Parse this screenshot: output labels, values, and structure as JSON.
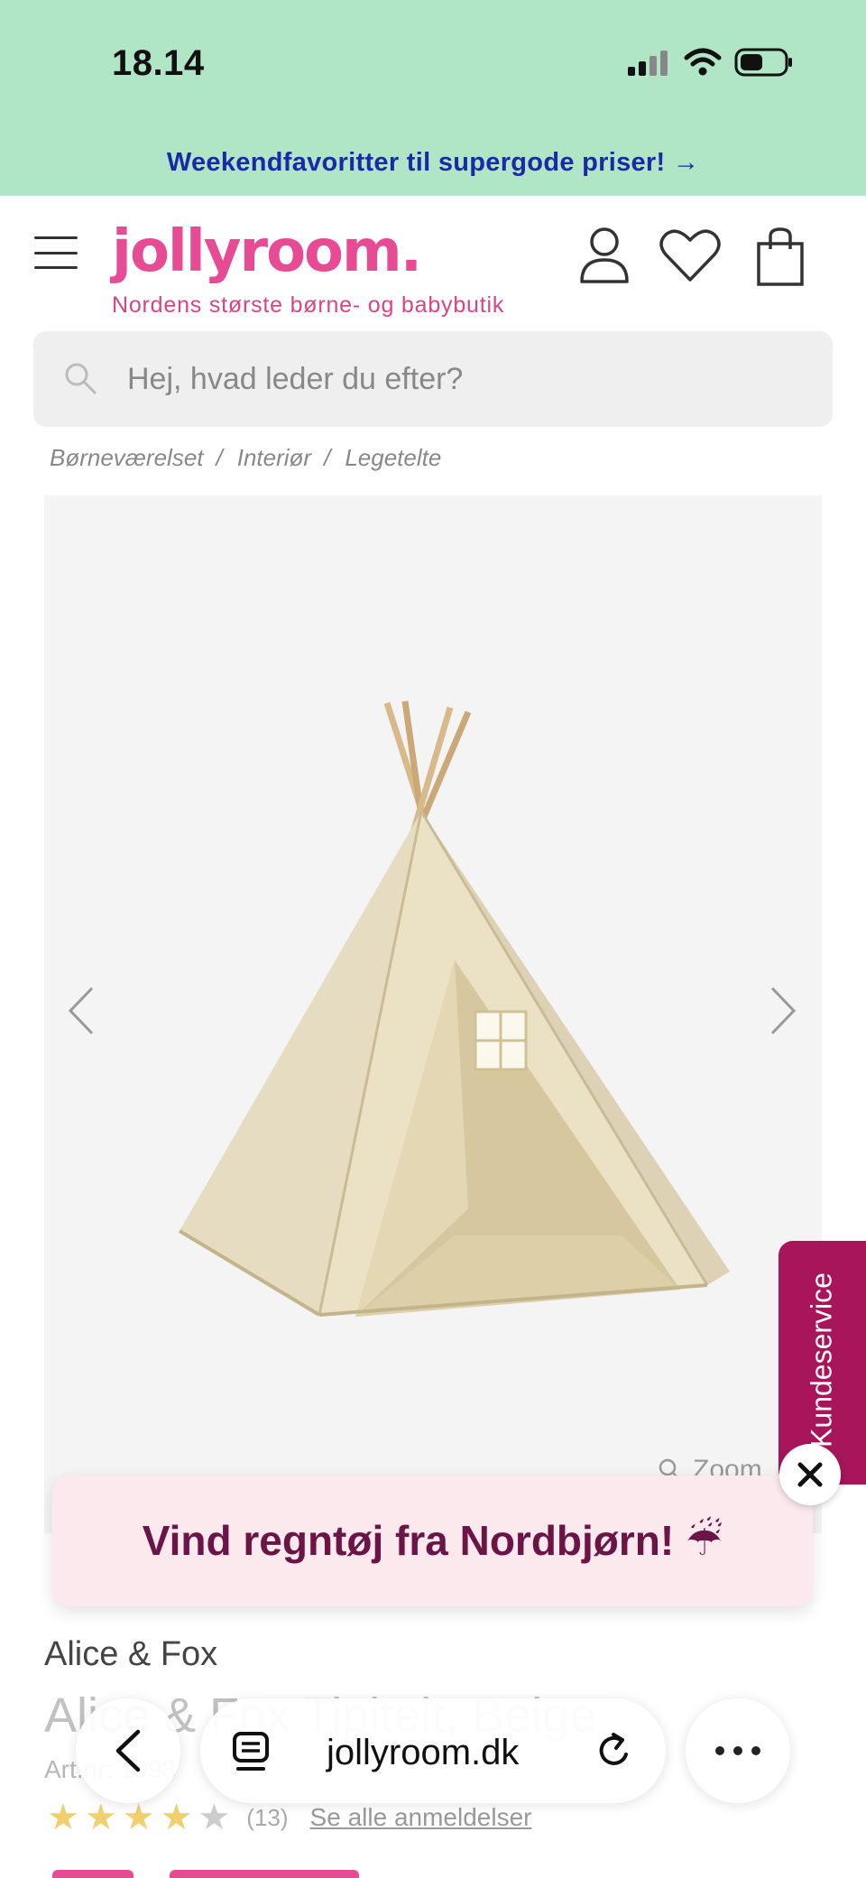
{
  "status_bar": {
    "time": "18.14"
  },
  "promo": {
    "text": "Weekendfavoritter til supergode priser! →"
  },
  "header": {
    "logo": "jollyroom.",
    "tagline": "Nordens største børne- og babybutik"
  },
  "search": {
    "placeholder": "Hej, hvad leder du efter?"
  },
  "breadcrumb": [
    "Børneværelset",
    "Interiør",
    "Legetelte"
  ],
  "product_image": {
    "zoom_label": "Zoom"
  },
  "service_tab": {
    "label": "Kundeservice"
  },
  "popup": {
    "text": "Vind regntøj fra Nordbjørn! ☔"
  },
  "product": {
    "brand": "Alice & Fox",
    "title": "Alice & Fox Tipitelt, Beige",
    "article_number": "Art.nr: 1098",
    "rating": {
      "value": 4,
      "max": 5,
      "count": "(13)",
      "link": "Se alle anmeldelser"
    }
  },
  "browser": {
    "url": "jollyroom.dk"
  },
  "colors": {
    "brand_pink": "#e64b93",
    "promo_bg": "#b0e5c6",
    "service_bg": "#a8155a"
  }
}
